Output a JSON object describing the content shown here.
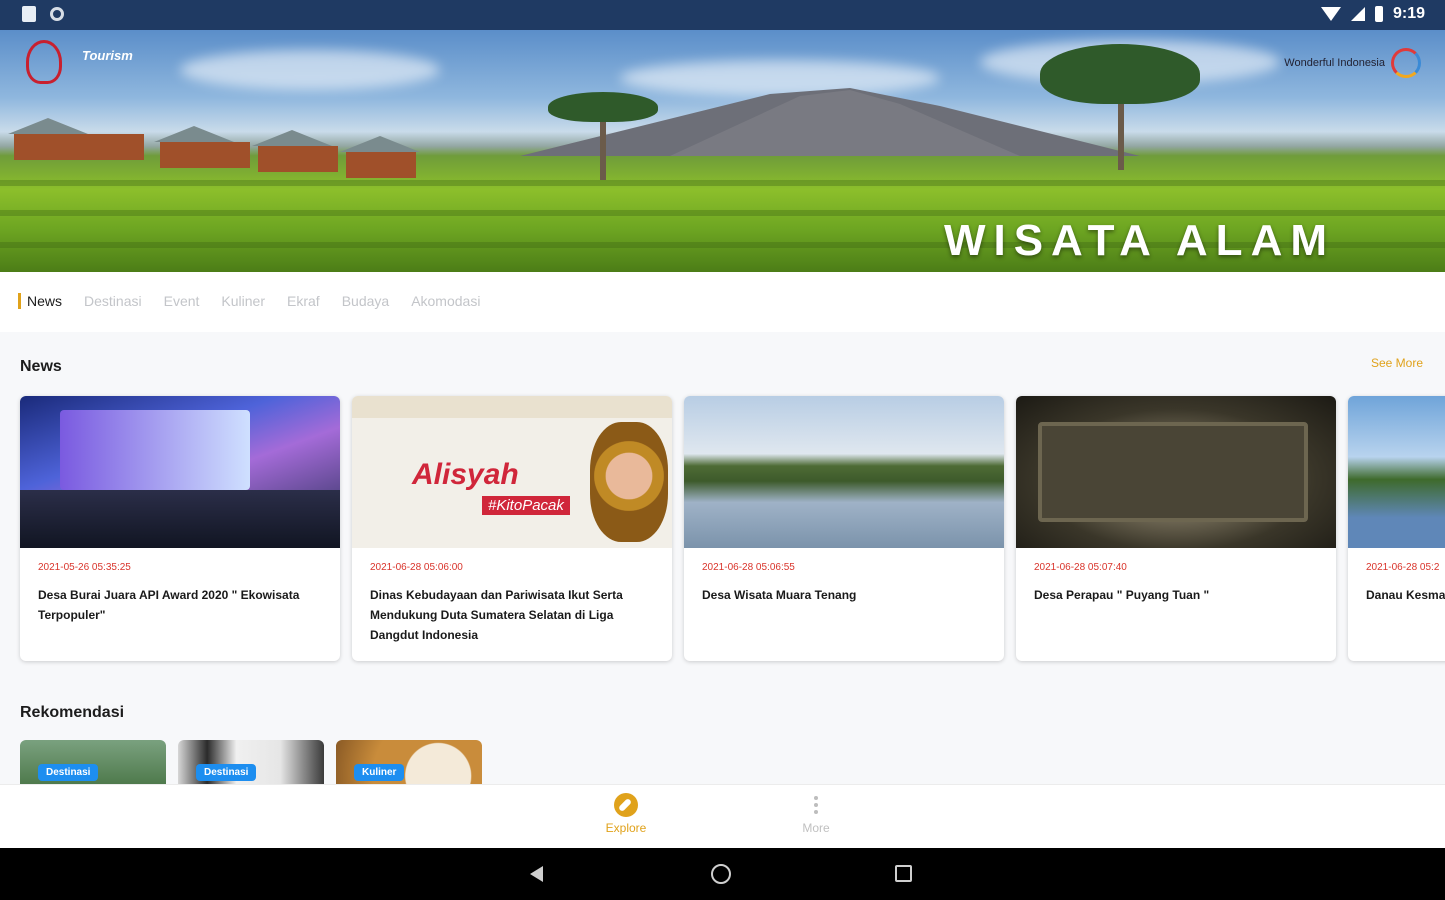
{
  "status_bar": {
    "time": "9:19"
  },
  "hero": {
    "title": "WISATA ALAM",
    "logo_left_text": "Tourism",
    "logo_right_text": "Wonderful Indonesia"
  },
  "tabs": [
    {
      "label": "News",
      "active": true
    },
    {
      "label": "Destinasi",
      "active": false
    },
    {
      "label": "Event",
      "active": false
    },
    {
      "label": "Kuliner",
      "active": false
    },
    {
      "label": "Ekraf",
      "active": false
    },
    {
      "label": "Budaya",
      "active": false
    },
    {
      "label": "Akomodasi",
      "active": false
    }
  ],
  "news": {
    "section_title": "News",
    "see_more_label": "See More",
    "items": [
      {
        "date": "2021-05-26 05:35:25",
        "title": "Desa Burai Juara API Award 2020 \" Ekowisata Terpopuler\""
      },
      {
        "date": "2021-06-28 05:06:00",
        "title": "Dinas Kebudayaan dan Pariwisata Ikut Serta Mendukung Duta Sumatera Selatan di Liga Dangdut Indonesia"
      },
      {
        "date": "2021-06-28 05:06:55",
        "title": "Desa Wisata Muara Tenang"
      },
      {
        "date": "2021-06-28 05:07:40",
        "title": "Desa Perapau \" Puyang Tuan \""
      },
      {
        "date": "2021-06-28 05:2",
        "title": "Danau Kesma"
      }
    ]
  },
  "card_images": {
    "news_2_banner_script": "Alisyah",
    "news_2_banner_tag": "#KitoPacak"
  },
  "rekomendasi": {
    "section_title": "Rekomendasi",
    "items": [
      {
        "badge": "Destinasi"
      },
      {
        "badge": "Destinasi"
      },
      {
        "badge": "Kuliner"
      }
    ]
  },
  "bottom_nav": {
    "explore_label": "Explore",
    "more_label": "More"
  },
  "colors": {
    "accent": "#e0a21b",
    "date_red": "#d9342b",
    "badge_blue": "#1d8ef0",
    "status_bar": "#1f3a63"
  }
}
